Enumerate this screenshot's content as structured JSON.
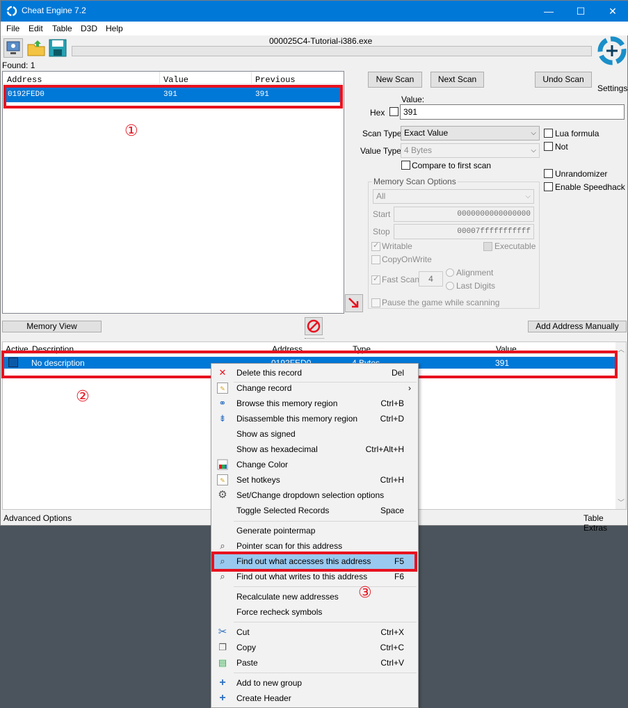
{
  "window": {
    "title": "Cheat Engine 7.2",
    "process_name": "000025C4-Tutorial-i386.exe",
    "found_label": "Found: 1",
    "settings_label": "Settings",
    "controls": {
      "minimize": "—",
      "maximize": "☐",
      "close": "✕"
    }
  },
  "menu": {
    "items": [
      "File",
      "Edit",
      "Table",
      "D3D",
      "Help"
    ]
  },
  "results": {
    "headers": {
      "address": "Address",
      "value": "Value",
      "previous": "Previous"
    },
    "rows": [
      {
        "address": "0192FED0",
        "value": "391",
        "previous": "391"
      }
    ]
  },
  "scan": {
    "new_scan": "New Scan",
    "next_scan": "Next Scan",
    "undo_scan": "Undo Scan",
    "value_label": "Value:",
    "hex_label": "Hex",
    "value": "391",
    "scan_type_label": "Scan Type",
    "scan_type": "Exact Value",
    "value_type_label": "Value Type",
    "value_type": "4 Bytes",
    "compare_first": "Compare to first scan",
    "lua_formula": "Lua formula",
    "not_label": "Not",
    "unrandomizer": "Unrandomizer",
    "speedhack": "Enable Speedhack"
  },
  "memory_options": {
    "title": "Memory Scan Options",
    "region": "All",
    "start_label": "Start",
    "start": "0000000000000000",
    "stop_label": "Stop",
    "stop": "00007fffffffffff",
    "writable": "Writable",
    "executable": "Executable",
    "copyonwrite": "CopyOnWrite",
    "fast_scan": "Fast Scan",
    "fast_scan_value": "4",
    "alignment": "Alignment",
    "last_digits": "Last Digits",
    "pause": "Pause the game while scanning"
  },
  "buttons": {
    "memory_view": "Memory View",
    "add_manual": "Add Address Manually"
  },
  "table": {
    "headers": {
      "active": "Active",
      "description": "Description",
      "address": "Address",
      "type": "Type",
      "value": "Value"
    },
    "rows": [
      {
        "description": "No description",
        "address": "0192FED0",
        "type": "4 Bytes",
        "value": "391"
      }
    ]
  },
  "status": {
    "left": "Advanced Options",
    "right": "Table Extras"
  },
  "annotations": {
    "one": "①",
    "two": "②",
    "three": "③"
  },
  "context_menu": {
    "items": [
      {
        "label": "Delete this record",
        "shortcut": "Del",
        "icon": "delete-icon"
      },
      {
        "label": "Change record",
        "shortcut": "›",
        "icon": "edit-record-icon"
      },
      {
        "label": "Browse this memory region",
        "shortcut": "Ctrl+B",
        "icon": "binoculars-icon"
      },
      {
        "label": "Disassemble this memory region",
        "shortcut": "Ctrl+D",
        "icon": "disassemble-icon"
      },
      {
        "label": "Show as signed",
        "shortcut": "",
        "icon": ""
      },
      {
        "label": "Show as hexadecimal",
        "shortcut": "Ctrl+Alt+H",
        "icon": ""
      },
      {
        "label": "Change Color",
        "shortcut": "",
        "icon": "color-icon"
      },
      {
        "label": "Set hotkeys",
        "shortcut": "Ctrl+H",
        "icon": "hotkey-icon"
      },
      {
        "label": "Set/Change dropdown selection options",
        "shortcut": "",
        "icon": "gear-icon"
      },
      {
        "label": "Toggle Selected Records",
        "shortcut": "Space",
        "icon": ""
      },
      {
        "label": "Generate pointermap",
        "shortcut": "",
        "icon": ""
      },
      {
        "label": "Pointer scan for this address",
        "shortcut": "",
        "icon": "magnifier-icon"
      },
      {
        "label": "Find out what accesses this address",
        "shortcut": "F5",
        "icon": "find-access-icon"
      },
      {
        "label": "Find out what writes to this address",
        "shortcut": "F6",
        "icon": "find-write-icon"
      },
      {
        "label": "Recalculate new addresses",
        "shortcut": "",
        "icon": ""
      },
      {
        "label": "Force recheck symbols",
        "shortcut": "",
        "icon": ""
      },
      {
        "label": "Cut",
        "shortcut": "Ctrl+X",
        "icon": "scissors-icon"
      },
      {
        "label": "Copy",
        "shortcut": "Ctrl+C",
        "icon": "copy-icon"
      },
      {
        "label": "Paste",
        "shortcut": "Ctrl+V",
        "icon": "paste-icon"
      },
      {
        "label": "Add to new group",
        "shortcut": "",
        "icon": "plus-icon"
      },
      {
        "label": "Create Header",
        "shortcut": "",
        "icon": "plus-icon"
      }
    ]
  },
  "colors": {
    "accent": "#0078d7",
    "annotation_red": "#e8121f",
    "highlight": "#99c9ef"
  }
}
